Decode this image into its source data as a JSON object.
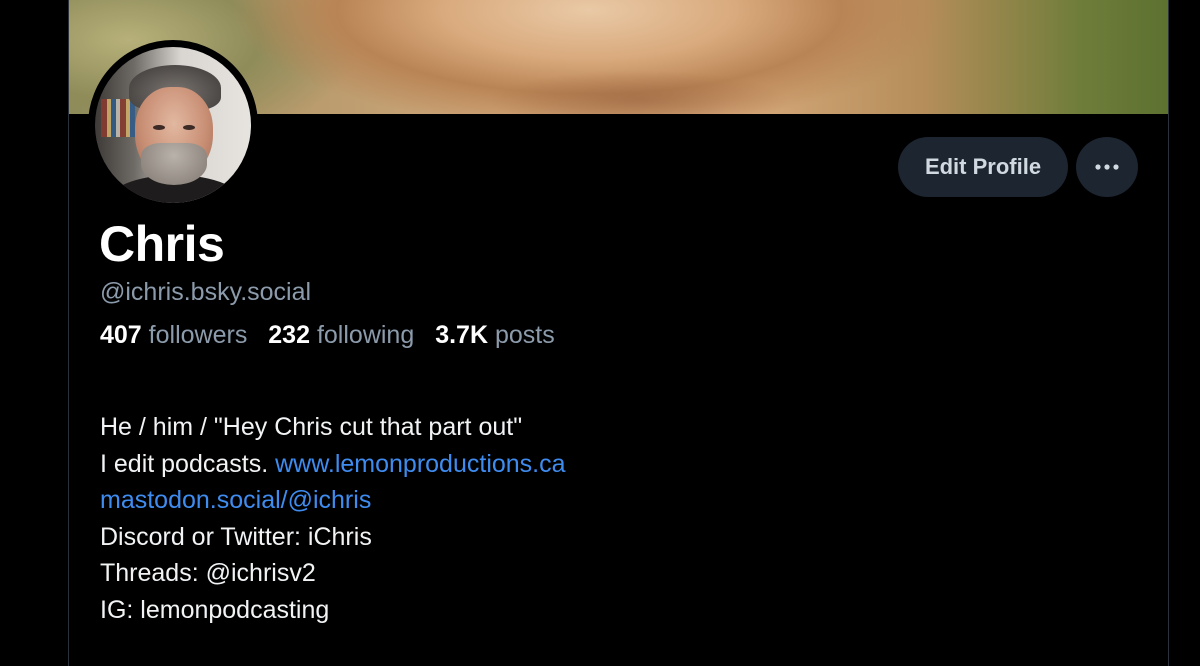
{
  "profile": {
    "display_name": "Chris",
    "handle": "@ichris.bsky.social",
    "stats": [
      {
        "value": "407",
        "label": "followers"
      },
      {
        "value": "232",
        "label": "following"
      },
      {
        "value": "3.7K",
        "label": "posts"
      }
    ],
    "bio": {
      "line1": "He / him / \"Hey Chris cut that part out\"",
      "line2_text": "I edit podcasts.",
      "line2_link": "www.lemonproductions.ca",
      "line3_link": "mastodon.social/@ichris",
      "line4": "Discord or Twitter: iChris",
      "line5": "Threads: @ichrisv2",
      "line6": "IG: lemonpodcasting"
    }
  },
  "actions": {
    "edit_profile_label": "Edit Profile",
    "more_icon": "ellipsis-icon"
  },
  "colors": {
    "background": "#000000",
    "button_bg": "#1c2530",
    "muted_text": "#8c9bab",
    "link": "#3f8cf0"
  }
}
